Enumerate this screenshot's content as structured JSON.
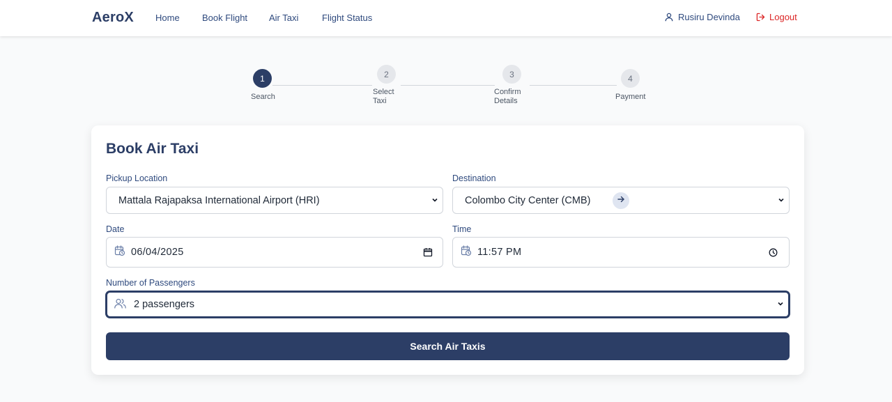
{
  "nav": {
    "brand": "AeroX",
    "links": [
      "Home",
      "Book Flight",
      "Air Taxi",
      "Flight Status"
    ],
    "user_name": "Rusiru Devinda",
    "logout_label": "Logout"
  },
  "stepper": {
    "steps": [
      {
        "number": "1",
        "label_line1": "Search",
        "label_line2": "",
        "state": "active"
      },
      {
        "number": "2",
        "label_line1": "Select",
        "label_line2": "Taxi",
        "state": "inactive"
      },
      {
        "number": "3",
        "label_line1": "Confirm",
        "label_line2": "Details",
        "state": "inactive"
      },
      {
        "number": "4",
        "label_line1": "Payment",
        "label_line2": "",
        "state": "inactive"
      }
    ]
  },
  "form": {
    "title": "Book Air Taxi",
    "pickup": {
      "label": "Pickup Location",
      "value": "Mattala Rajapaksa International Airport (HRI)"
    },
    "destination": {
      "label": "Destination",
      "value": "Colombo City Center (CMB)"
    },
    "date": {
      "label": "Date",
      "value": "06/04/2025"
    },
    "time": {
      "label": "Time",
      "value": "11:57 PM"
    },
    "passengers": {
      "label": "Number of Passengers",
      "value": "2 passengers"
    },
    "submit_label": "Search Air Taxis"
  },
  "colors": {
    "primary": "#2c3e66",
    "danger": "#dc2626",
    "background": "#f9fafb"
  }
}
